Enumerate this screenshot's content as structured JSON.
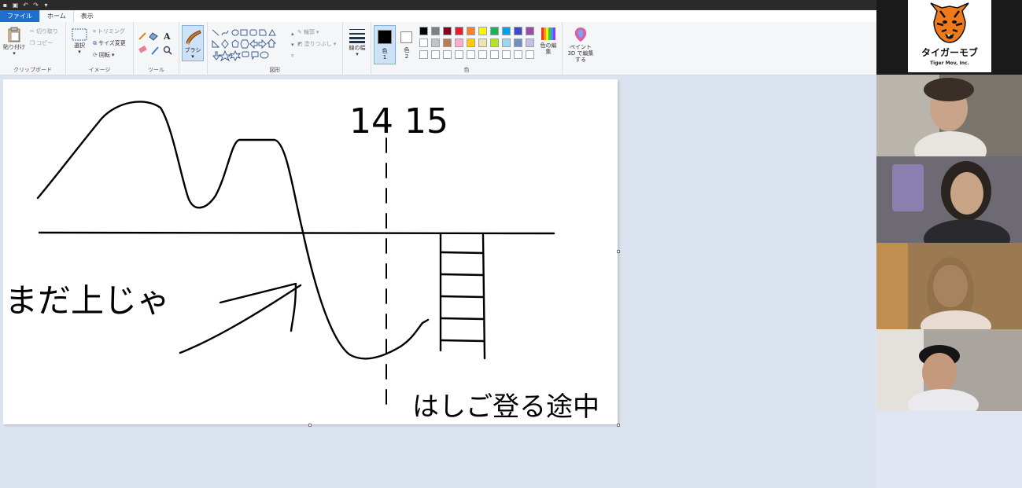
{
  "ribbon": {
    "tabs": [
      "ファイル",
      "ホーム",
      "表示"
    ],
    "clipboard": {
      "paste": "貼り付け",
      "cut": "切り取り",
      "copy": "コピー",
      "label": "クリップボード"
    },
    "image": {
      "select": "選択",
      "crop": "トリミング",
      "resize": "サイズ変更",
      "rotate": "回転",
      "label": "イメージ"
    },
    "tools": {
      "label": "ツール"
    },
    "brush": {
      "label": "ブラシ"
    },
    "shapes": {
      "outline": "輪郭",
      "fill": "塗りつぶし",
      "label": "図形"
    },
    "size": {
      "label": "線の幅"
    },
    "colors": {
      "color1": "色",
      "color1_num": "1",
      "color2": "色",
      "color2_num": "2",
      "edit": "色の編集",
      "label": "色",
      "palette_row1": [
        "#000000",
        "#7f7f7f",
        "#880015",
        "#ed1c24",
        "#ff7f27",
        "#fff200",
        "#22b14c",
        "#00a2e8",
        "#3f48cc",
        "#a349a4"
      ],
      "palette_row2": [
        "#ffffff",
        "#c3c3c3",
        "#b97a57",
        "#ffaec9",
        "#ffc90e",
        "#efe4b0",
        "#b5e61d",
        "#99d9ea",
        "#7092be",
        "#c8bfe7"
      ],
      "palette_row3": [
        "#ffffff",
        "#ffffff",
        "#ffffff",
        "#ffffff",
        "#ffffff",
        "#ffffff",
        "#ffffff",
        "#ffffff",
        "#ffffff",
        "#ffffff"
      ]
    },
    "paint3d": {
      "label": "ペイント 3D で編集する"
    }
  },
  "canvas": {
    "text_time": "14 15",
    "text_left": "まだ上じゃ",
    "text_bottom": "はしご登る途中"
  },
  "video": {
    "logo_title": "タイガーモブ",
    "logo_sub": "Tiger Mov, Inc."
  },
  "icons": [
    "save-icon",
    "undo-icon",
    "redo-icon",
    "pencil-icon",
    "fill-icon",
    "text-icon",
    "eraser-icon",
    "color-picker-icon",
    "magnifier-icon",
    "brush-icon",
    "tiger-logo-icon"
  ]
}
